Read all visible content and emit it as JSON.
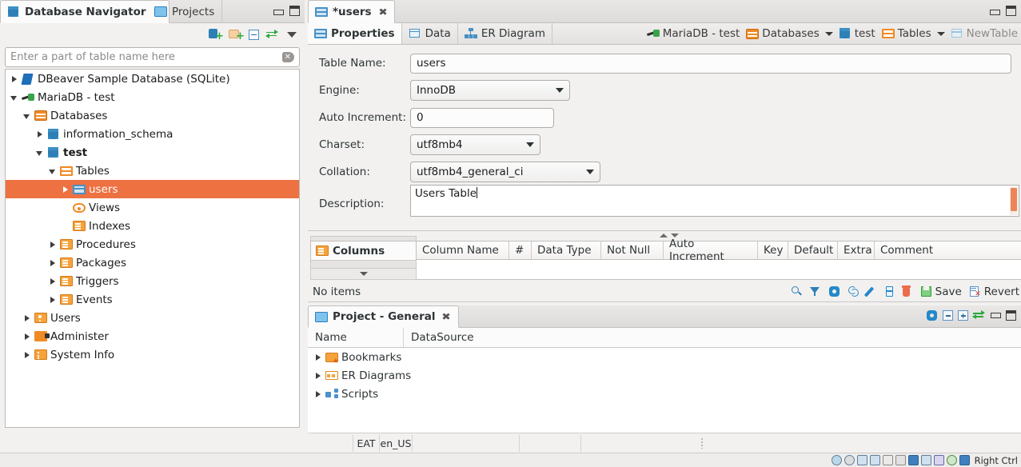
{
  "navigator": {
    "tabs": [
      {
        "label": "Database Navigator",
        "icon": "database-icon",
        "active": true,
        "closable": true
      },
      {
        "label": "Projects",
        "icon": "projects-icon",
        "active": false,
        "closable": false
      }
    ],
    "toolbar": [
      {
        "name": "new-connection-icon",
        "title": "New Connection"
      },
      {
        "name": "new-folder-icon",
        "title": "New Folder"
      },
      {
        "name": "collapse-all-icon",
        "title": "Collapse All"
      },
      {
        "name": "link-with-editor-icon",
        "title": "Link with Editor"
      },
      {
        "name": "view-menu-icon",
        "title": "View Menu"
      }
    ],
    "filter": {
      "placeholder": "Enter a part of table name here",
      "value": "",
      "clear_icon": "clear-icon"
    },
    "tree": [
      {
        "label": "DBeaver Sample Database (SQLite)",
        "indent": 0,
        "arrow": "right",
        "icon": "sqlite-icon",
        "bold": false,
        "selected": false
      },
      {
        "label": "MariaDB - test",
        "indent": 0,
        "arrow": "down",
        "icon": "mariadb-icon",
        "bold": false,
        "selected": false
      },
      {
        "label": "Databases",
        "indent": 1,
        "arrow": "down",
        "icon": "databases-folder-icon",
        "bold": false,
        "selected": false
      },
      {
        "label": "information_schema",
        "indent": 2,
        "arrow": "right",
        "icon": "schema-icon",
        "bold": false,
        "selected": false
      },
      {
        "label": "test",
        "indent": 2,
        "arrow": "down",
        "icon": "schema-icon",
        "bold": true,
        "selected": false
      },
      {
        "label": "Tables",
        "indent": 3,
        "arrow": "down",
        "icon": "tables-folder-icon",
        "bold": false,
        "selected": false
      },
      {
        "label": "users",
        "indent": 4,
        "arrow": "right",
        "icon": "table-icon",
        "bold": false,
        "selected": true
      },
      {
        "label": "Views",
        "indent": 4,
        "arrow": "none",
        "icon": "view-icon",
        "bold": false,
        "selected": false
      },
      {
        "label": "Indexes",
        "indent": 4,
        "arrow": "none",
        "icon": "index-folder-icon",
        "bold": false,
        "selected": false
      },
      {
        "label": "Procedures",
        "indent": 3,
        "arrow": "right",
        "icon": "procedures-folder-icon",
        "bold": false,
        "selected": false
      },
      {
        "label": "Packages",
        "indent": 3,
        "arrow": "right",
        "icon": "packages-folder-icon",
        "bold": false,
        "selected": false
      },
      {
        "label": "Triggers",
        "indent": 3,
        "arrow": "right",
        "icon": "triggers-folder-icon",
        "bold": false,
        "selected": false
      },
      {
        "label": "Events",
        "indent": 3,
        "arrow": "right",
        "icon": "events-folder-icon",
        "bold": false,
        "selected": false
      },
      {
        "label": "Users",
        "indent": 1,
        "arrow": "right",
        "icon": "users-folder-icon",
        "bold": false,
        "selected": false
      },
      {
        "label": "Administer",
        "indent": 1,
        "arrow": "right",
        "icon": "administer-folder-icon",
        "bold": false,
        "selected": false
      },
      {
        "label": "System Info",
        "indent": 1,
        "arrow": "right",
        "icon": "system-info-folder-icon",
        "bold": false,
        "selected": false
      }
    ]
  },
  "editor": {
    "tab": {
      "label": "*users",
      "icon": "table-icon",
      "close_icon": "close-icon"
    },
    "subtabs": [
      {
        "label": "Properties",
        "icon": "table-icon",
        "active": true
      },
      {
        "label": "Data",
        "icon": "data-grid-icon",
        "active": false
      },
      {
        "label": "ER Diagram",
        "icon": "er-diagram-icon",
        "active": false
      }
    ],
    "breadcrumb": [
      {
        "label": "MariaDB - test",
        "icon": "mariadb-icon",
        "caret": false,
        "muted": false
      },
      {
        "label": "Databases",
        "icon": "databases-folder-icon",
        "caret": true,
        "muted": false
      },
      {
        "label": "test",
        "icon": "schema-icon",
        "caret": false,
        "muted": false
      },
      {
        "label": "Tables",
        "icon": "tables-folder-icon",
        "caret": true,
        "muted": false
      },
      {
        "label": "NewTable",
        "icon": "table-icon",
        "caret": false,
        "muted": true
      }
    ],
    "form": {
      "table_name": {
        "label": "Table Name:",
        "value": "users"
      },
      "engine": {
        "label": "Engine:",
        "value": "InnoDB"
      },
      "auto_increment": {
        "label": "Auto Increment:",
        "value": "0"
      },
      "charset": {
        "label": "Charset:",
        "value": "utf8mb4"
      },
      "collation": {
        "label": "Collation:",
        "value": "utf8mb4_general_ci"
      },
      "description": {
        "label": "Description:",
        "value": "Users Table"
      }
    },
    "columns_panel": {
      "tab_label": "Columns",
      "tab_icon": "columns-icon",
      "headers": [
        "Column Name",
        "#",
        "Data Type",
        "Not Null",
        "Auto Increment",
        "Key",
        "Default",
        "Extra",
        "Comment"
      ],
      "rows": [],
      "empty_text": "No items",
      "toolbar": [
        {
          "name": "search-icon"
        },
        {
          "name": "filter-icon"
        },
        {
          "name": "settings-gear-icon"
        },
        {
          "name": "refresh-icon"
        },
        {
          "name": "edit-pencil-icon"
        },
        {
          "name": "copy-icon"
        },
        {
          "name": "delete-trash-icon"
        }
      ],
      "save_label": "Save",
      "save_icon": "save-disk-icon",
      "revert_label": "Revert",
      "revert_icon": "revert-icon"
    }
  },
  "project_panel": {
    "tab": {
      "label": "Project - General",
      "icon": "project-icon",
      "close_icon": "close-icon"
    },
    "toolbar": [
      {
        "name": "settings-gear-icon"
      },
      {
        "name": "collapse-all-icon"
      },
      {
        "name": "expand-all-icon"
      },
      {
        "name": "link-with-editor-icon"
      },
      {
        "name": "minimize-icon"
      },
      {
        "name": "maximize-icon"
      }
    ],
    "headers": [
      "Name",
      "DataSource"
    ],
    "rows": [
      {
        "name": "Bookmarks",
        "datasource": "",
        "icon": "bookmarks-folder-icon",
        "arrow": "right"
      },
      {
        "name": "ER Diagrams",
        "datasource": "",
        "icon": "er-diagrams-folder-icon",
        "arrow": "right"
      },
      {
        "name": "Scripts",
        "datasource": "",
        "icon": "scripts-folder-icon",
        "arrow": "right"
      }
    ]
  },
  "status_bar": {
    "cells": [
      "",
      "EAT",
      "en_US",
      "",
      "",
      "",
      ""
    ]
  },
  "vbox_bar": {
    "label": "Right Ctrl",
    "icons": [
      "hdd-icon",
      "optical-disk-icon",
      "floppy-icon",
      "network-icon",
      "usb-icon",
      "shared-folder-icon",
      "display-icon",
      "video-capture-icon",
      "remote-desktop-icon",
      "mouse-icon",
      "keyboard-icon"
    ]
  },
  "colors": {
    "selection": "#ed7141",
    "accent_orange": "#f08a24",
    "accent_blue": "#4a90c4",
    "panel_bg": "#f2f1f0"
  }
}
